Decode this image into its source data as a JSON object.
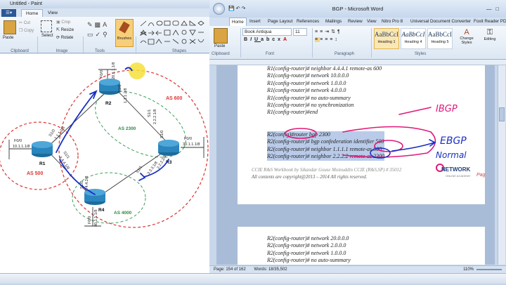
{
  "paint": {
    "title": "Untitled - Paint",
    "tabs": {
      "home": "Home",
      "view": "View"
    },
    "clipboard": {
      "paste": "Paste",
      "cut": "Cut",
      "copy": "Copy",
      "group": "Clipboard"
    },
    "image": {
      "select": "Select",
      "crop": "Crop",
      "resize": "Resize",
      "rotate": "Rotate",
      "group": "Image"
    },
    "tools_group": "Tools",
    "brushes": "Brushes",
    "shapes_group": "Shapes"
  },
  "diagram": {
    "as_labels": {
      "as600": "AS 600",
      "as2300": "AS 2300",
      "as500": "AS 500",
      "as4000": "AS 4000"
    },
    "routers": {
      "r1": "R1",
      "r2": "R2",
      "r3": "R3",
      "r4": "R4"
    },
    "interfaces": {
      "r1_f00": "F0/0",
      "r1_net": "10.1.1.1/8",
      "r2_f00": "F0/0",
      "r2_net": "20.1.1.1/8",
      "r3_f00": "F0/0",
      "r3_net": "30.1.1.1/8",
      "r4_f00": "F0/0",
      "r4_net": "40.1.1.1/8",
      "r1r2_a": "S1/0",
      "r1r2_b": "1.1.1.1/8",
      "r1r4_a": "S1/1",
      "r1r4_b": "4.4.4.1/8",
      "r2_s10": "S1/0",
      "r2_ip1": "1.1.1.2/8",
      "r2r3_a": "S1/1",
      "r2r3_b": "2.2.2.1/8",
      "r3_s10": "S1/0",
      "r3_ip": "2.2.2.2/8",
      "r4r3_a": "S1/1",
      "r4r3_b": "3.3.3.1/8",
      "r4_s10": "S1/0",
      "r4_ip": "4.4.4.2/8"
    }
  },
  "word": {
    "title": "BGP - Microsoft Word",
    "tabs": [
      "Home",
      "Insert",
      "Page Layout",
      "References",
      "Mailings",
      "Review",
      "View",
      "Nitro Pro 8",
      "Universal Document Converter",
      "Foxit Reader PDF"
    ],
    "clipboard_group": "Clipboard",
    "paste": "Paste",
    "font_name": "Book Antiqua",
    "font_size": "11",
    "font_group": "Font",
    "paragraph_group": "Paragraph",
    "styles": [
      {
        "sample": "AaBbCcI",
        "name": "Heading 1"
      },
      {
        "sample": "AaBbCcI",
        "name": "Heading 4"
      },
      {
        "sample": "AaBbCcI",
        "name": "Heading 5"
      }
    ],
    "change_styles": "Change Styles",
    "styles_group": "Styles",
    "editing": "Editing",
    "code_lines_1": [
      "R1(config-router)#  neighbor 4.4.4.1 remote-as 600",
      "R1(config-router)#  network 10.0.0.0",
      "R1(config-router)#  network 1.0.0.0",
      "R1(config-router)#  network 4.0.0.0",
      "R1(config-router)#  no auto-summary",
      "R1(config-router)#  no synchronization",
      "R1(config-router)#end"
    ],
    "code_lines_hl": [
      "R2(config)#router bgp 2300",
      "R2(config-router)#  bgp confederation identifier 500",
      "R2(config-router)#  neighbor 1.1.1.1 remote-as 500",
      "R2(config-router)#  neighbor 2.2.2.2 remote-as 2300"
    ],
    "footer_1": "CCIE R&S Workbook by Sikandar Gouse Moinuddin CCIE (R&S,SP) # 35012",
    "footer_2": "All contents are copyright@2013 – 2014 All rights reserved.",
    "page_label": "Pag",
    "logo": {
      "name": "NETWORK",
      "sub": "ONLINE ACADEMY"
    },
    "code_lines_2": [
      "R2(config-router)#  network 20.0.0.0",
      "R2(config-router)#  network 2.0.0.0",
      "R2(config-router)#  network 1.0.0.0",
      "R2(config-router)#  no auto-summary"
    ],
    "status_page": "Page: 154 of 162",
    "status_words": "Words: 18/35,502",
    "zoom": "110%"
  },
  "annotations": {
    "ibgp": "IBGP",
    "ebgp": "EBGP",
    "normal": "Normal"
  },
  "colors": {
    "accent": "#2b5797",
    "annotation_pink": "#e0187a",
    "annotation_blue": "#1a2fc4",
    "highlight": "#b9cbe9",
    "red_dash": "#e03030"
  }
}
